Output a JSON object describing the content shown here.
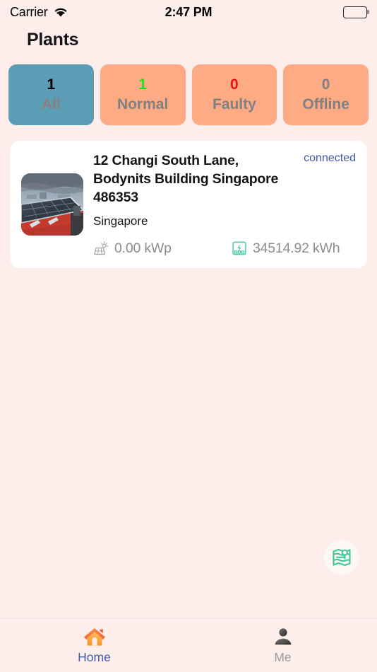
{
  "status_bar": {
    "carrier": "Carrier",
    "wifi_icon": "wifi-icon",
    "time": "2:47 PM",
    "battery_icon": "battery-full-icon"
  },
  "header": {
    "title": "Plants"
  },
  "filters": {
    "tabs": [
      {
        "count": "1",
        "label": "All",
        "active": true,
        "count_color": "#000000"
      },
      {
        "count": "1",
        "label": "Normal",
        "active": false,
        "count_color": "#22dd22"
      },
      {
        "count": "0",
        "label": "Faulty",
        "active": false,
        "count_color": "#ee1111"
      },
      {
        "count": "0",
        "label": "Offline",
        "active": false,
        "count_color": "#808080"
      }
    ],
    "active_bg": "#5b9db4",
    "inactive_bg": "#fdab84"
  },
  "plants": [
    {
      "thumbnail_icon": "solar-panel-photo",
      "title": "12 Changi South Lane, Bodynits Building Singapore 486353",
      "location": "Singapore",
      "status": "connected",
      "status_color": "#3f5cab",
      "power": {
        "icon": "solar-panel-icon",
        "value": "0.00 kWp"
      },
      "energy": {
        "icon": "power-station-icon",
        "value": "34514.92 kWh"
      }
    }
  ],
  "map_fab": {
    "icon": "map-pin-icon",
    "color": "#3fc99a"
  },
  "tab_bar": {
    "items": [
      {
        "label": "Home",
        "icon": "home-icon",
        "active": true
      },
      {
        "label": "Me",
        "icon": "person-icon",
        "active": false
      }
    ],
    "active_color": "#3f5cab",
    "inactive_color": "#9b9b9b"
  }
}
